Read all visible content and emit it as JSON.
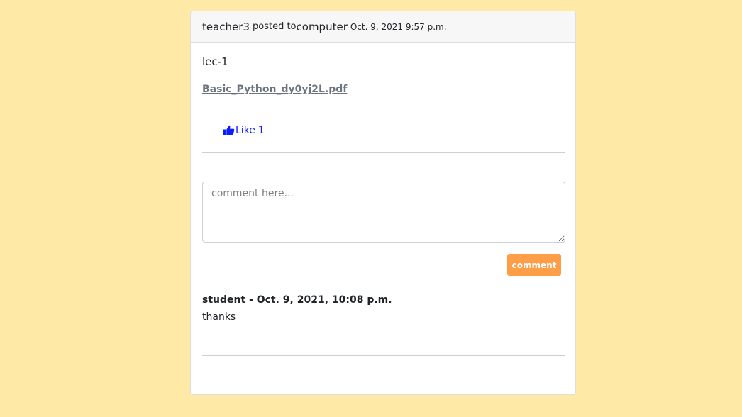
{
  "post": {
    "author": "teacher3",
    "posted_to_label": "posted to",
    "subject": "computer",
    "date": "Oct. 9, 2021 9:57 p.m.",
    "title": "lec-1",
    "attachment": "Basic_Python_dy0yj2L.pdf",
    "like_label": "Like",
    "like_count": "1"
  },
  "comment_form": {
    "placeholder": "comment here...",
    "value": "",
    "submit_label": "comment"
  },
  "comments": [
    {
      "meta": "student - Oct. 9, 2021, 10:08 p.m.",
      "text": "thanks"
    }
  ],
  "colors": {
    "page_background": "#ffe9a6",
    "like_blue": "#0d1cff",
    "comment_button": "#ff9e48",
    "link_gray": "#6c757d"
  },
  "icons": {
    "like": "thumbs-up-icon"
  }
}
